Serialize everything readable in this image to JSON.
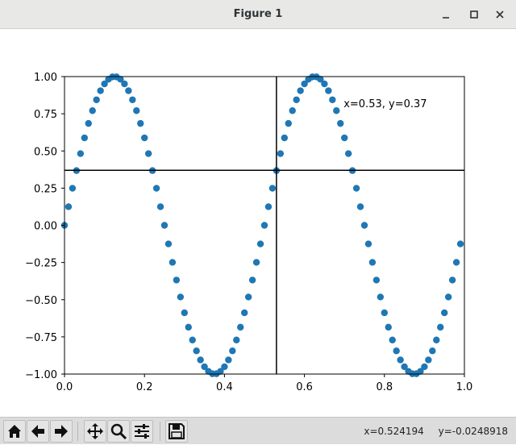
{
  "window": {
    "title": "Figure 1",
    "minimize_glyph": "—",
    "maximize_glyph": "☐",
    "close_glyph": "✕"
  },
  "chart_data": {
    "type": "scatter",
    "title": "",
    "xlabel": "",
    "ylabel": "",
    "xlim": [
      0,
      1
    ],
    "ylim": [
      -1,
      1
    ],
    "x_ticks": [
      "0.0",
      "0.2",
      "0.4",
      "0.6",
      "0.8",
      "1.0"
    ],
    "y_ticks": [
      "1.00",
      "0.75",
      "0.50",
      "0.25",
      "0.00",
      "−0.25",
      "−0.50",
      "−0.75",
      "−1.00"
    ],
    "grid": false,
    "legend": "none",
    "marker_color": "#1f77b4",
    "series": [
      {
        "function": "sin(4*pi*x)",
        "x": [
          0.0,
          0.01,
          0.02,
          0.03,
          0.04,
          0.05,
          0.06,
          0.07,
          0.08,
          0.09,
          0.1,
          0.11,
          0.12,
          0.13,
          0.14,
          0.15,
          0.16,
          0.17,
          0.18,
          0.19,
          0.2,
          0.21,
          0.22,
          0.23,
          0.24,
          0.25,
          0.26,
          0.27,
          0.28,
          0.29,
          0.3,
          0.31,
          0.32,
          0.33,
          0.34,
          0.35,
          0.36,
          0.37,
          0.38,
          0.39,
          0.4,
          0.41,
          0.42,
          0.43,
          0.44,
          0.45,
          0.46,
          0.47,
          0.48,
          0.49,
          0.5,
          0.51,
          0.52,
          0.53,
          0.54,
          0.55,
          0.56,
          0.57,
          0.58,
          0.59,
          0.6,
          0.61,
          0.62,
          0.63,
          0.64,
          0.65,
          0.66,
          0.67,
          0.68,
          0.69,
          0.7,
          0.71,
          0.72,
          0.73,
          0.74,
          0.75,
          0.76,
          0.77,
          0.78,
          0.79,
          0.8,
          0.81,
          0.82,
          0.83,
          0.84,
          0.85,
          0.86,
          0.87,
          0.88,
          0.89,
          0.9,
          0.91,
          0.92,
          0.93,
          0.94,
          0.95,
          0.96,
          0.97,
          0.98,
          0.99
        ],
        "y": [
          0.0,
          0.125,
          0.249,
          0.368,
          0.482,
          0.588,
          0.685,
          0.771,
          0.844,
          0.905,
          0.951,
          0.982,
          0.998,
          0.998,
          0.982,
          0.951,
          0.905,
          0.844,
          0.771,
          0.685,
          0.588,
          0.482,
          0.368,
          0.249,
          0.125,
          0.0,
          -0.125,
          -0.249,
          -0.368,
          -0.482,
          -0.588,
          -0.685,
          -0.771,
          -0.844,
          -0.905,
          -0.951,
          -0.982,
          -0.998,
          -0.998,
          -0.982,
          -0.951,
          -0.905,
          -0.844,
          -0.771,
          -0.685,
          -0.588,
          -0.482,
          -0.368,
          -0.249,
          -0.125,
          0.0,
          0.125,
          0.249,
          0.368,
          0.482,
          0.588,
          0.685,
          0.771,
          0.844,
          0.905,
          0.951,
          0.982,
          0.998,
          0.998,
          0.982,
          0.951,
          0.905,
          0.844,
          0.771,
          0.685,
          0.588,
          0.482,
          0.368,
          0.249,
          0.125,
          0.0,
          -0.125,
          -0.249,
          -0.368,
          -0.482,
          -0.588,
          -0.685,
          -0.771,
          -0.844,
          -0.905,
          -0.951,
          -0.982,
          -0.998,
          -0.998,
          -0.982,
          -0.951,
          -0.905,
          -0.844,
          -0.771,
          -0.685,
          -0.588,
          -0.482,
          -0.368,
          -0.249,
          -0.125
        ]
      }
    ],
    "cursor": {
      "x": 0.53,
      "y": 0.37,
      "label": "x=0.53, y=0.37"
    }
  },
  "toolbar": {
    "buttons": [
      "home-icon",
      "back-arrow-icon",
      "forward-arrow-icon",
      "pan-icon",
      "zoom-icon",
      "subplots-icon",
      "save-icon"
    ]
  },
  "status": {
    "x_readout": "x=0.524194",
    "y_readout": "y=-0.0248918"
  }
}
